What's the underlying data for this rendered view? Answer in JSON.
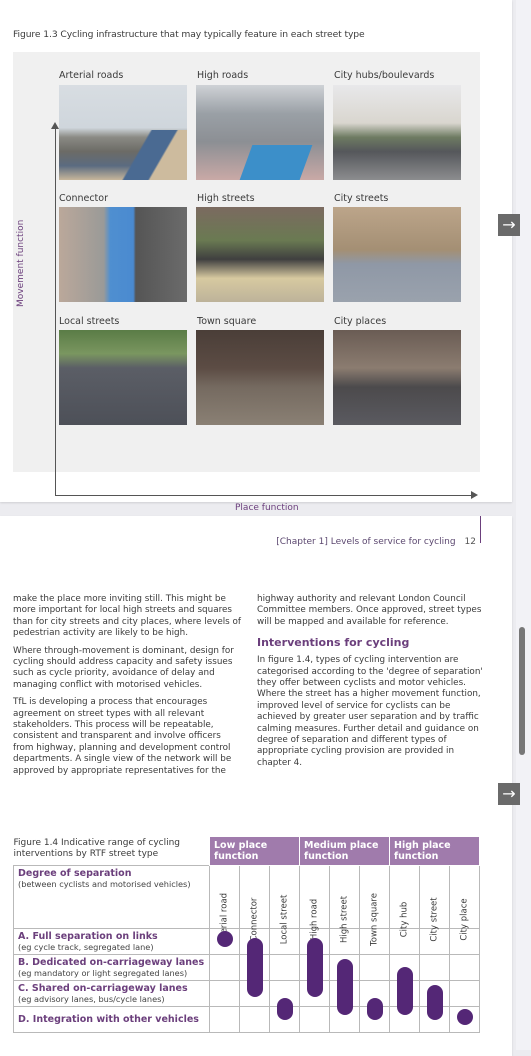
{
  "page1": {
    "figure_caption": "Figure 1.3 Cycling infrastructure that may typically feature in each street type",
    "y_axis_label": "Movement function",
    "x_axis_label": "Place function",
    "grid": [
      {
        "label": "Arterial roads",
        "photo": "arterial-roads-photo"
      },
      {
        "label": "High roads",
        "photo": "high-roads-photo"
      },
      {
        "label": "City hubs/boulevards",
        "photo": "city-hubs-photo"
      },
      {
        "label": "Connector",
        "photo": "connector-photo"
      },
      {
        "label": "High streets",
        "photo": "high-streets-photo"
      },
      {
        "label": "City streets",
        "photo": "city-streets-photo"
      },
      {
        "label": "Local streets",
        "photo": "local-streets-photo"
      },
      {
        "label": "Town square",
        "photo": "town-square-photo"
      },
      {
        "label": "City places",
        "photo": "city-places-photo"
      }
    ]
  },
  "viewer": {
    "next_arrow_icon": "→",
    "accent_color": "#6b3f7c",
    "pill_color": "#542776",
    "header_color": "#a07bac"
  },
  "page2": {
    "running_head": "[Chapter 1] Levels of service for cycling",
    "page_number": "12",
    "left_column": [
      "make the place more inviting still. This might be more important for local high streets and squares than for city streets and city places, where levels of pedestrian activity are likely to be high.",
      "Where through-movement is dominant, design for cycling should address capacity and safety issues such as cycle priority, avoidance of delay and managing conflict with motorised vehicles.",
      "TfL is developing a process that encourages agreement on street types with all relevant stakeholders. This process will be repeatable, consistent and transparent and involve officers from highway, planning and development control departments. A single view of the network will be approved by appropriate representatives for the"
    ],
    "right_column_intro": "highway authority and relevant London Council Committee members. Once approved, street types will be mapped and available for reference.",
    "section_heading": "Interventions for cycling",
    "right_column_body": "In figure 1.4, types of cycling intervention are categorised according to the 'degree of separation' they offer between cyclists and motor vehicles. Where the street has a higher movement function, improved level of service for cyclists can be achieved by greater user separation and by traffic calming measures. Further detail and guidance on degree of separation and different types of appropriate cycling provision are provided in chapter 4.",
    "figure14": {
      "caption": "Figure 1.4 Indicative range of cycling interventions by RTF street type",
      "degree_title": "Degree of separation",
      "degree_subtitle": "(between cyclists and motorised vehicles)",
      "groups": [
        "Low place function",
        "Medium place function",
        "High place function"
      ],
      "columns": [
        "Arterial road",
        "Connector",
        "Local street",
        "High road",
        "High street",
        "Town square",
        "City hub",
        "City street",
        "City place"
      ],
      "rows": [
        {
          "title": "A. Full separation on links",
          "sub": "(eg cycle track, segregated lane)"
        },
        {
          "title": "B. Dedicated on-carriageway lanes",
          "sub": "(eg mandatory or light segregated lanes)"
        },
        {
          "title": "C. Shared on-carriageway lanes",
          "sub": "(eg advisory lanes, bus/cycle lanes)"
        },
        {
          "title": "D. Integration with other vehicles",
          "sub": ""
        }
      ],
      "ranges": [
        {
          "column": "Arterial road",
          "from_row": 0,
          "to_row": 0.5
        },
        {
          "column": "Connector",
          "from_row": 0.3,
          "to_row": 2.7
        },
        {
          "column": "Local street",
          "from_row": 2.6,
          "to_row": 3.6
        },
        {
          "column": "High road",
          "from_row": 0.3,
          "to_row": 2.7
        },
        {
          "column": "High street",
          "from_row": 1.1,
          "to_row": 3.4
        },
        {
          "column": "Town square",
          "from_row": 2.6,
          "to_row": 3.6
        },
        {
          "column": "City hub",
          "from_row": 1.4,
          "to_row": 3.4
        },
        {
          "column": "City street",
          "from_row": 2.1,
          "to_row": 3.6
        },
        {
          "column": "City place",
          "from_row": 3.0,
          "to_row": 3.6
        }
      ]
    }
  }
}
